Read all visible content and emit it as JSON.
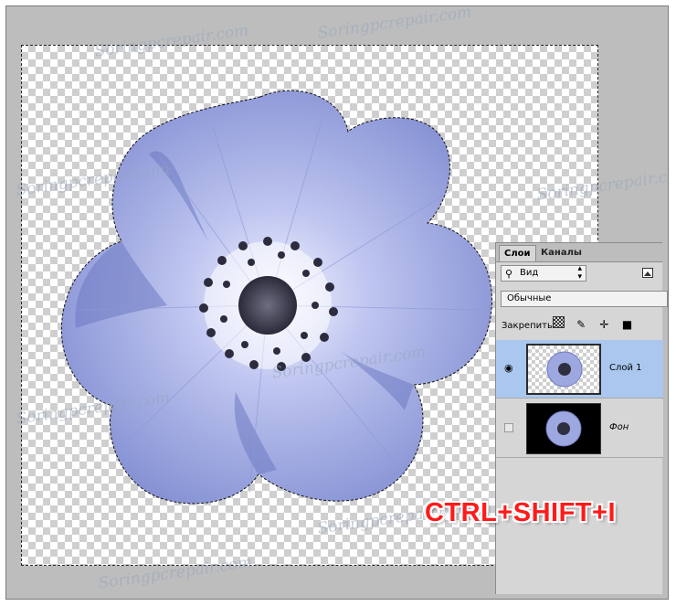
{
  "layers_panel": {
    "tabs": [
      {
        "label": "Слои",
        "active": true
      },
      {
        "label": "Каналы",
        "active": false
      }
    ],
    "filter": {
      "label": "Вид",
      "icon": "search-icon"
    },
    "blend_mode": "Обычные",
    "lock_label": "Закрепить:",
    "lock_icons": [
      "lock-transparent-icon",
      "brush-icon",
      "move-icon",
      "lock-icon"
    ],
    "layers": [
      {
        "name": "Слой 1",
        "visible": true,
        "selected": true
      },
      {
        "name": "Фон",
        "visible": false,
        "selected": false
      }
    ]
  },
  "canvas": {
    "watermark": "Soringpcrepair.com",
    "subject": "flower"
  },
  "overlay": {
    "shortcut": "CTRL+SHIFT+I",
    "shortcut_color": "#ff1a1a"
  },
  "colors": {
    "workspace": "#bdbdbd",
    "panel": "#d6d6d6",
    "selected_layer": "#a9c7ef",
    "petal": "#9ea8e0"
  }
}
